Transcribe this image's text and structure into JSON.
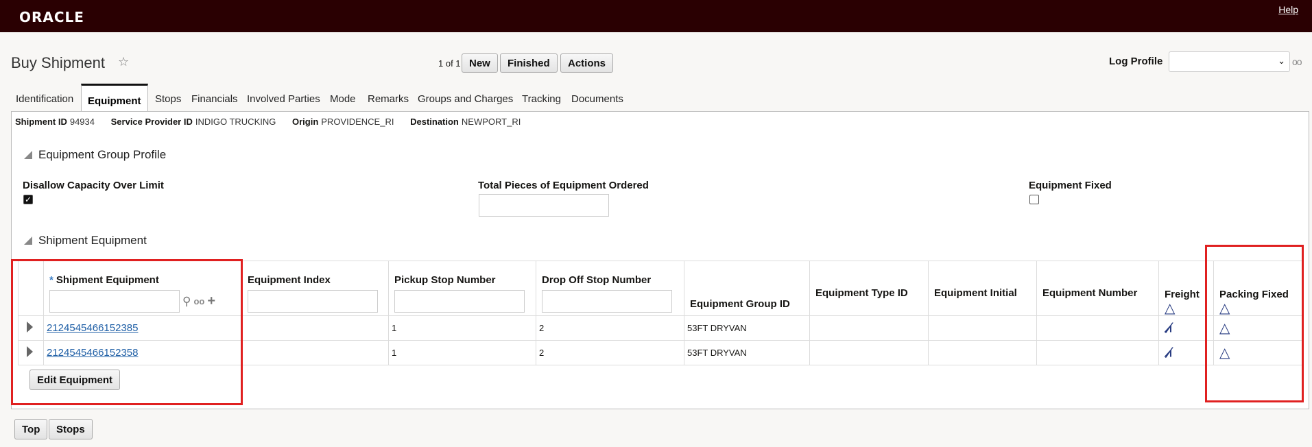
{
  "header": {
    "logo": "ORACLE",
    "help": "Help"
  },
  "page": {
    "title": "Buy Shipment",
    "pager": "1 of 1"
  },
  "actions": {
    "new": "New",
    "finished": "Finished",
    "actions": "Actions"
  },
  "log_profile": {
    "label": "Log Profile",
    "value": ""
  },
  "tabs": [
    "Identification",
    "Equipment",
    "Stops",
    "Financials",
    "Involved Parties",
    "Mode",
    "Remarks",
    "Groups and Charges",
    "Tracking",
    "Documents"
  ],
  "info": {
    "shipment_id_label": "Shipment ID",
    "shipment_id": "94934",
    "provider_label": "Service Provider ID",
    "provider": "INDIGO TRUCKING",
    "origin_label": "Origin",
    "origin": "PROVIDENCE_RI",
    "destination_label": "Destination",
    "destination": "NEWPORT_RI"
  },
  "group_profile": {
    "title": "Equipment Group Profile",
    "disallow_label": "Disallow Capacity Over Limit",
    "disallow_checked": true,
    "total_pieces_label": "Total Pieces of Equipment Ordered",
    "total_pieces_value": "",
    "fixed_label": "Equipment Fixed",
    "fixed_checked": false
  },
  "shipment_equipment": {
    "title": "Shipment Equipment",
    "columns": [
      "Shipment Equipment",
      "Equipment Index",
      "Pickup Stop Number",
      "Drop Off Stop Number",
      "Equipment Group ID",
      "Equipment Type ID",
      "Equipment Initial",
      "Equipment Number",
      "Freight",
      "Packing Fixed"
    ],
    "rows": [
      {
        "id": "2124545466152385",
        "index": "",
        "pickup": "1",
        "dropoff": "2",
        "group": "53FT DRYVAN",
        "type": "",
        "initial": "",
        "number": ""
      },
      {
        "id": "2124545466152358",
        "index": "",
        "pickup": "1",
        "dropoff": "2",
        "group": "53FT DRYVAN",
        "type": "",
        "initial": "",
        "number": ""
      }
    ],
    "edit_button": "Edit Equipment"
  },
  "bottom": {
    "top": "Top",
    "stops": "Stops"
  }
}
